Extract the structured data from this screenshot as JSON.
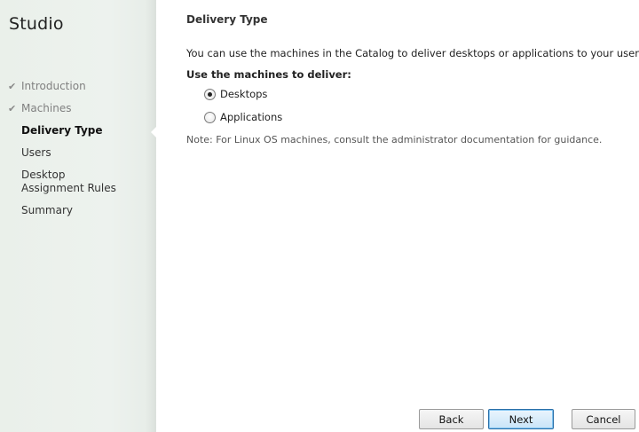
{
  "app": {
    "title": "Studio"
  },
  "steps": [
    {
      "label": "Introduction",
      "state": "completed"
    },
    {
      "label": "Machines",
      "state": "completed"
    },
    {
      "label": "Delivery Type",
      "state": "current"
    },
    {
      "label": "Users",
      "state": "pending"
    },
    {
      "label": "Desktop Assignment Rules",
      "state": "pending"
    },
    {
      "label": "Summary",
      "state": "pending"
    }
  ],
  "page": {
    "title": "Delivery Type",
    "description": "You can use the machines in the Catalog to deliver desktops or applications to your users.",
    "group_label": "Use the machines to deliver:",
    "options": [
      {
        "label": "Desktops",
        "selected": true
      },
      {
        "label": "Applications",
        "selected": false
      }
    ],
    "note": "Note: For Linux OS machines, consult the administrator documentation for guidance."
  },
  "buttons": {
    "back": "Back",
    "next": "Next",
    "cancel": "Cancel"
  },
  "icons": {
    "completed_step": "check-icon",
    "radio": "radio-button"
  },
  "colors": {
    "sidebar_bg": "#edf2ee",
    "next_border": "#2a6fa8"
  }
}
